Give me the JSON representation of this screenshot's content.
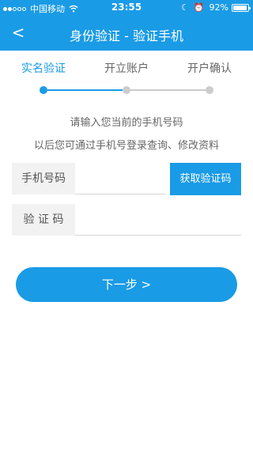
{
  "status_bar": {
    "carrier": "中国移动",
    "time": "23:55",
    "battery": "92%",
    "battery_level": 0.92,
    "signal_bars_filled": 2,
    "signal_bars_total": 5,
    "icons": [
      "wifi-icon",
      "moon-icon",
      "alarm-icon",
      "battery-icon"
    ]
  },
  "nav": {
    "back_label": "<",
    "title": "身份验证 - 验证手机"
  },
  "steps": [
    {
      "label": "实名验证",
      "active": true
    },
    {
      "label": "开立账户",
      "active": false
    },
    {
      "label": "开户确认",
      "active": false
    }
  ],
  "instructions": {
    "line1": "请输入您当前的手机号码",
    "line2": "以后您可通过手机号登录查询、修改资料"
  },
  "form": {
    "phone_label": "手机号码",
    "phone_value": "",
    "phone_placeholder": "",
    "get_code_label": "获取验证码",
    "code_label": "验 证 码",
    "code_value": "",
    "code_placeholder": ""
  },
  "next_button": {
    "label": "下一步 >"
  },
  "colors": {
    "accent": "#1a9be6",
    "inactive": "#cccccc",
    "field_bg": "#f2f2f2"
  }
}
